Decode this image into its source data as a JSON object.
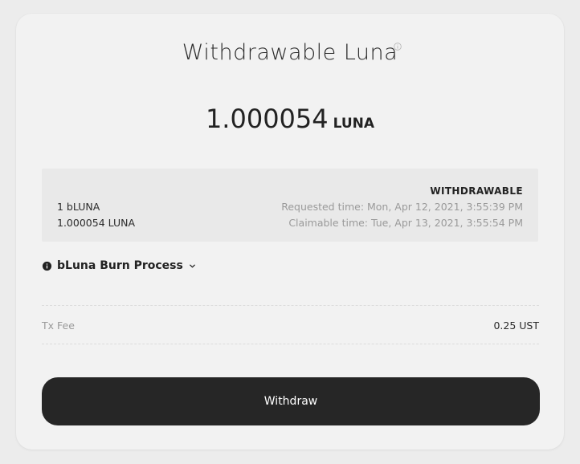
{
  "header": {
    "title": "Withdrawable Luna",
    "info_icon": "info-circle-icon"
  },
  "balance": {
    "amount": "1.000054",
    "unit": "LUNA"
  },
  "history": {
    "status": "WITHDRAWABLE",
    "burn_amount": "1 bLUNA",
    "receive_amount": "1.000054 LUNA",
    "requested_time": "Requested time: Mon, Apr 12, 2021, 3:55:39 PM",
    "claimable_time": "Claimable time: Tue, Apr 13, 2021, 3:55:54 PM"
  },
  "burn_process": {
    "label": "bLuna Burn Process",
    "icon": "info-filled-icon",
    "expand_icon": "chevron-down-icon"
  },
  "fee": {
    "label": "Tx Fee",
    "value": "0.25 UST"
  },
  "actions": {
    "withdraw_label": "Withdraw"
  },
  "colors": {
    "background": "#ececec",
    "card": "#f2f2f2",
    "history_box": "#e9e9e9",
    "button": "#262626",
    "muted_text": "#9a9a9a",
    "text": "#222222"
  }
}
